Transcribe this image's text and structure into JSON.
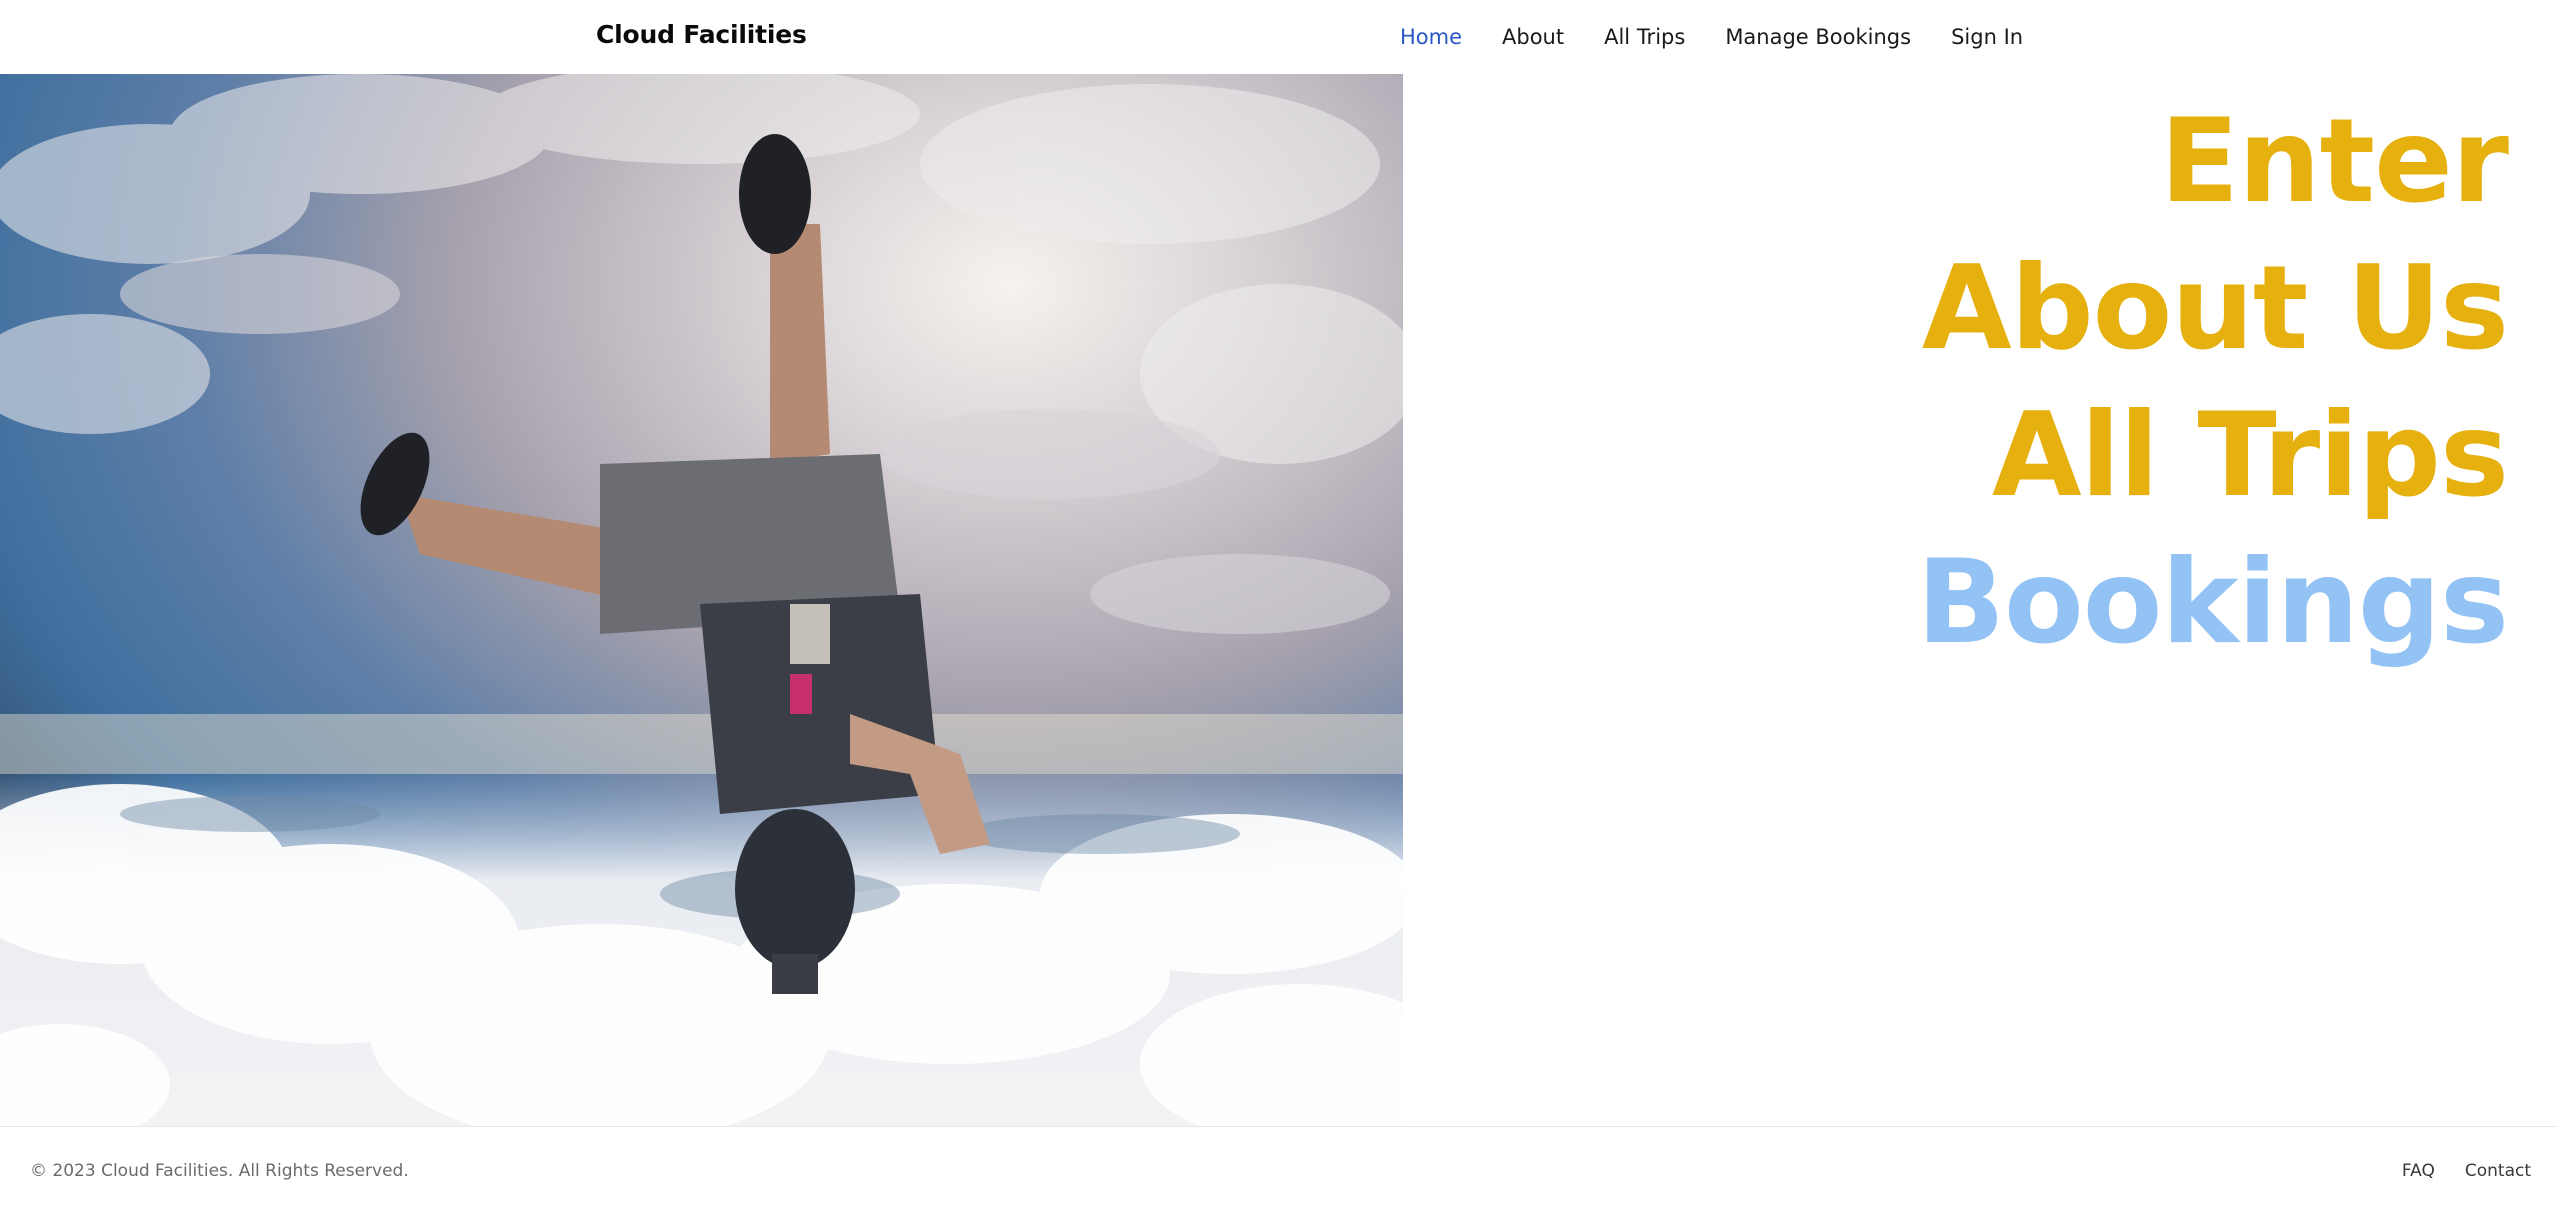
{
  "nav": {
    "brand": "Cloud Facilities",
    "links": [
      {
        "label": "Home",
        "active": true
      },
      {
        "label": "About"
      },
      {
        "label": "All Trips"
      },
      {
        "label": "Manage Bookings"
      },
      {
        "label": "Sign In"
      }
    ]
  },
  "hero": {
    "image": {
      "subject": "skydiver-freefall-above-clouds"
    },
    "words": [
      {
        "text": "Enter",
        "color": "#e6b00f"
      },
      {
        "text": "About Us",
        "color": "#e6b00f"
      },
      {
        "text": "All Trips",
        "color": "#e6b00f"
      },
      {
        "text": "Bookings",
        "color": "#93c2f5"
      }
    ]
  },
  "footer": {
    "copyright": "© 2023 Cloud Facilities. All Rights Reserved.",
    "links": [
      {
        "label": "FAQ"
      },
      {
        "label": "Contact"
      }
    ]
  },
  "colors": {
    "nav_active": "#2a56c6",
    "accent_gold": "#e6b00f",
    "accent_blue": "#93c2f5"
  }
}
